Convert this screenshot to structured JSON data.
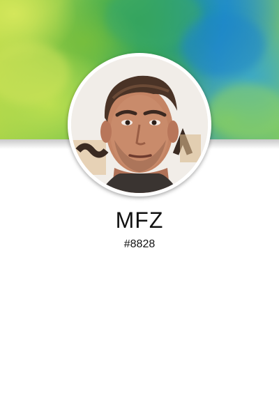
{
  "profile": {
    "display_name": "MFZ",
    "user_tag": "#8828",
    "avatar_icon": "user-avatar-photo",
    "banner_style": "green-blue-watercolor"
  },
  "colors": {
    "background": "#ffffff",
    "text": "#111111",
    "banner_green": "#6fbf4a",
    "banner_blue": "#2c8fc6",
    "banner_yellow": "#b9d949"
  }
}
